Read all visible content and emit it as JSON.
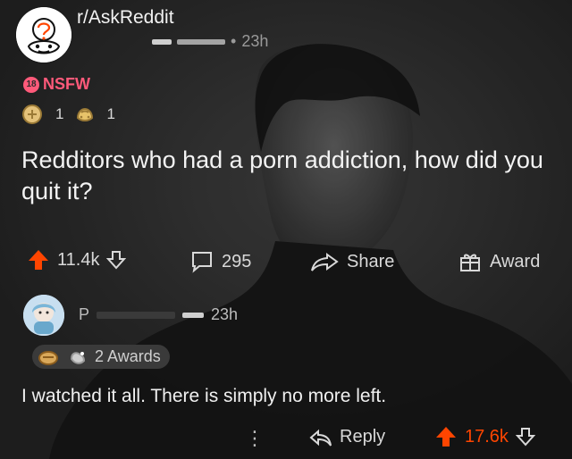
{
  "post": {
    "subreddit": "r/AskReddit",
    "time": "23h",
    "nsfw_label": "NSFW",
    "nsfw_badge": "18",
    "awards": [
      {
        "icon": "award-coin-icon",
        "count": "1"
      },
      {
        "icon": "award-hands-icon",
        "count": "1"
      }
    ],
    "title": "Redditors who had a porn addiction, how did you quit it?",
    "actions": {
      "upvotes": "11.4k",
      "comments": "295",
      "share": "Share",
      "award": "Award"
    }
  },
  "comment": {
    "username_initial": "P",
    "time": "23h",
    "awards_label": "2 Awards",
    "text": "I watched it all. There is simply no more left.",
    "actions": {
      "reply": "Reply",
      "upvotes": "17.6k"
    }
  },
  "colors": {
    "background": "#2a2a2a",
    "upvote": "#ff4500",
    "nsfw": "#ff5a7a",
    "text": "#f0f0f0",
    "muted": "#9a9a9a"
  }
}
